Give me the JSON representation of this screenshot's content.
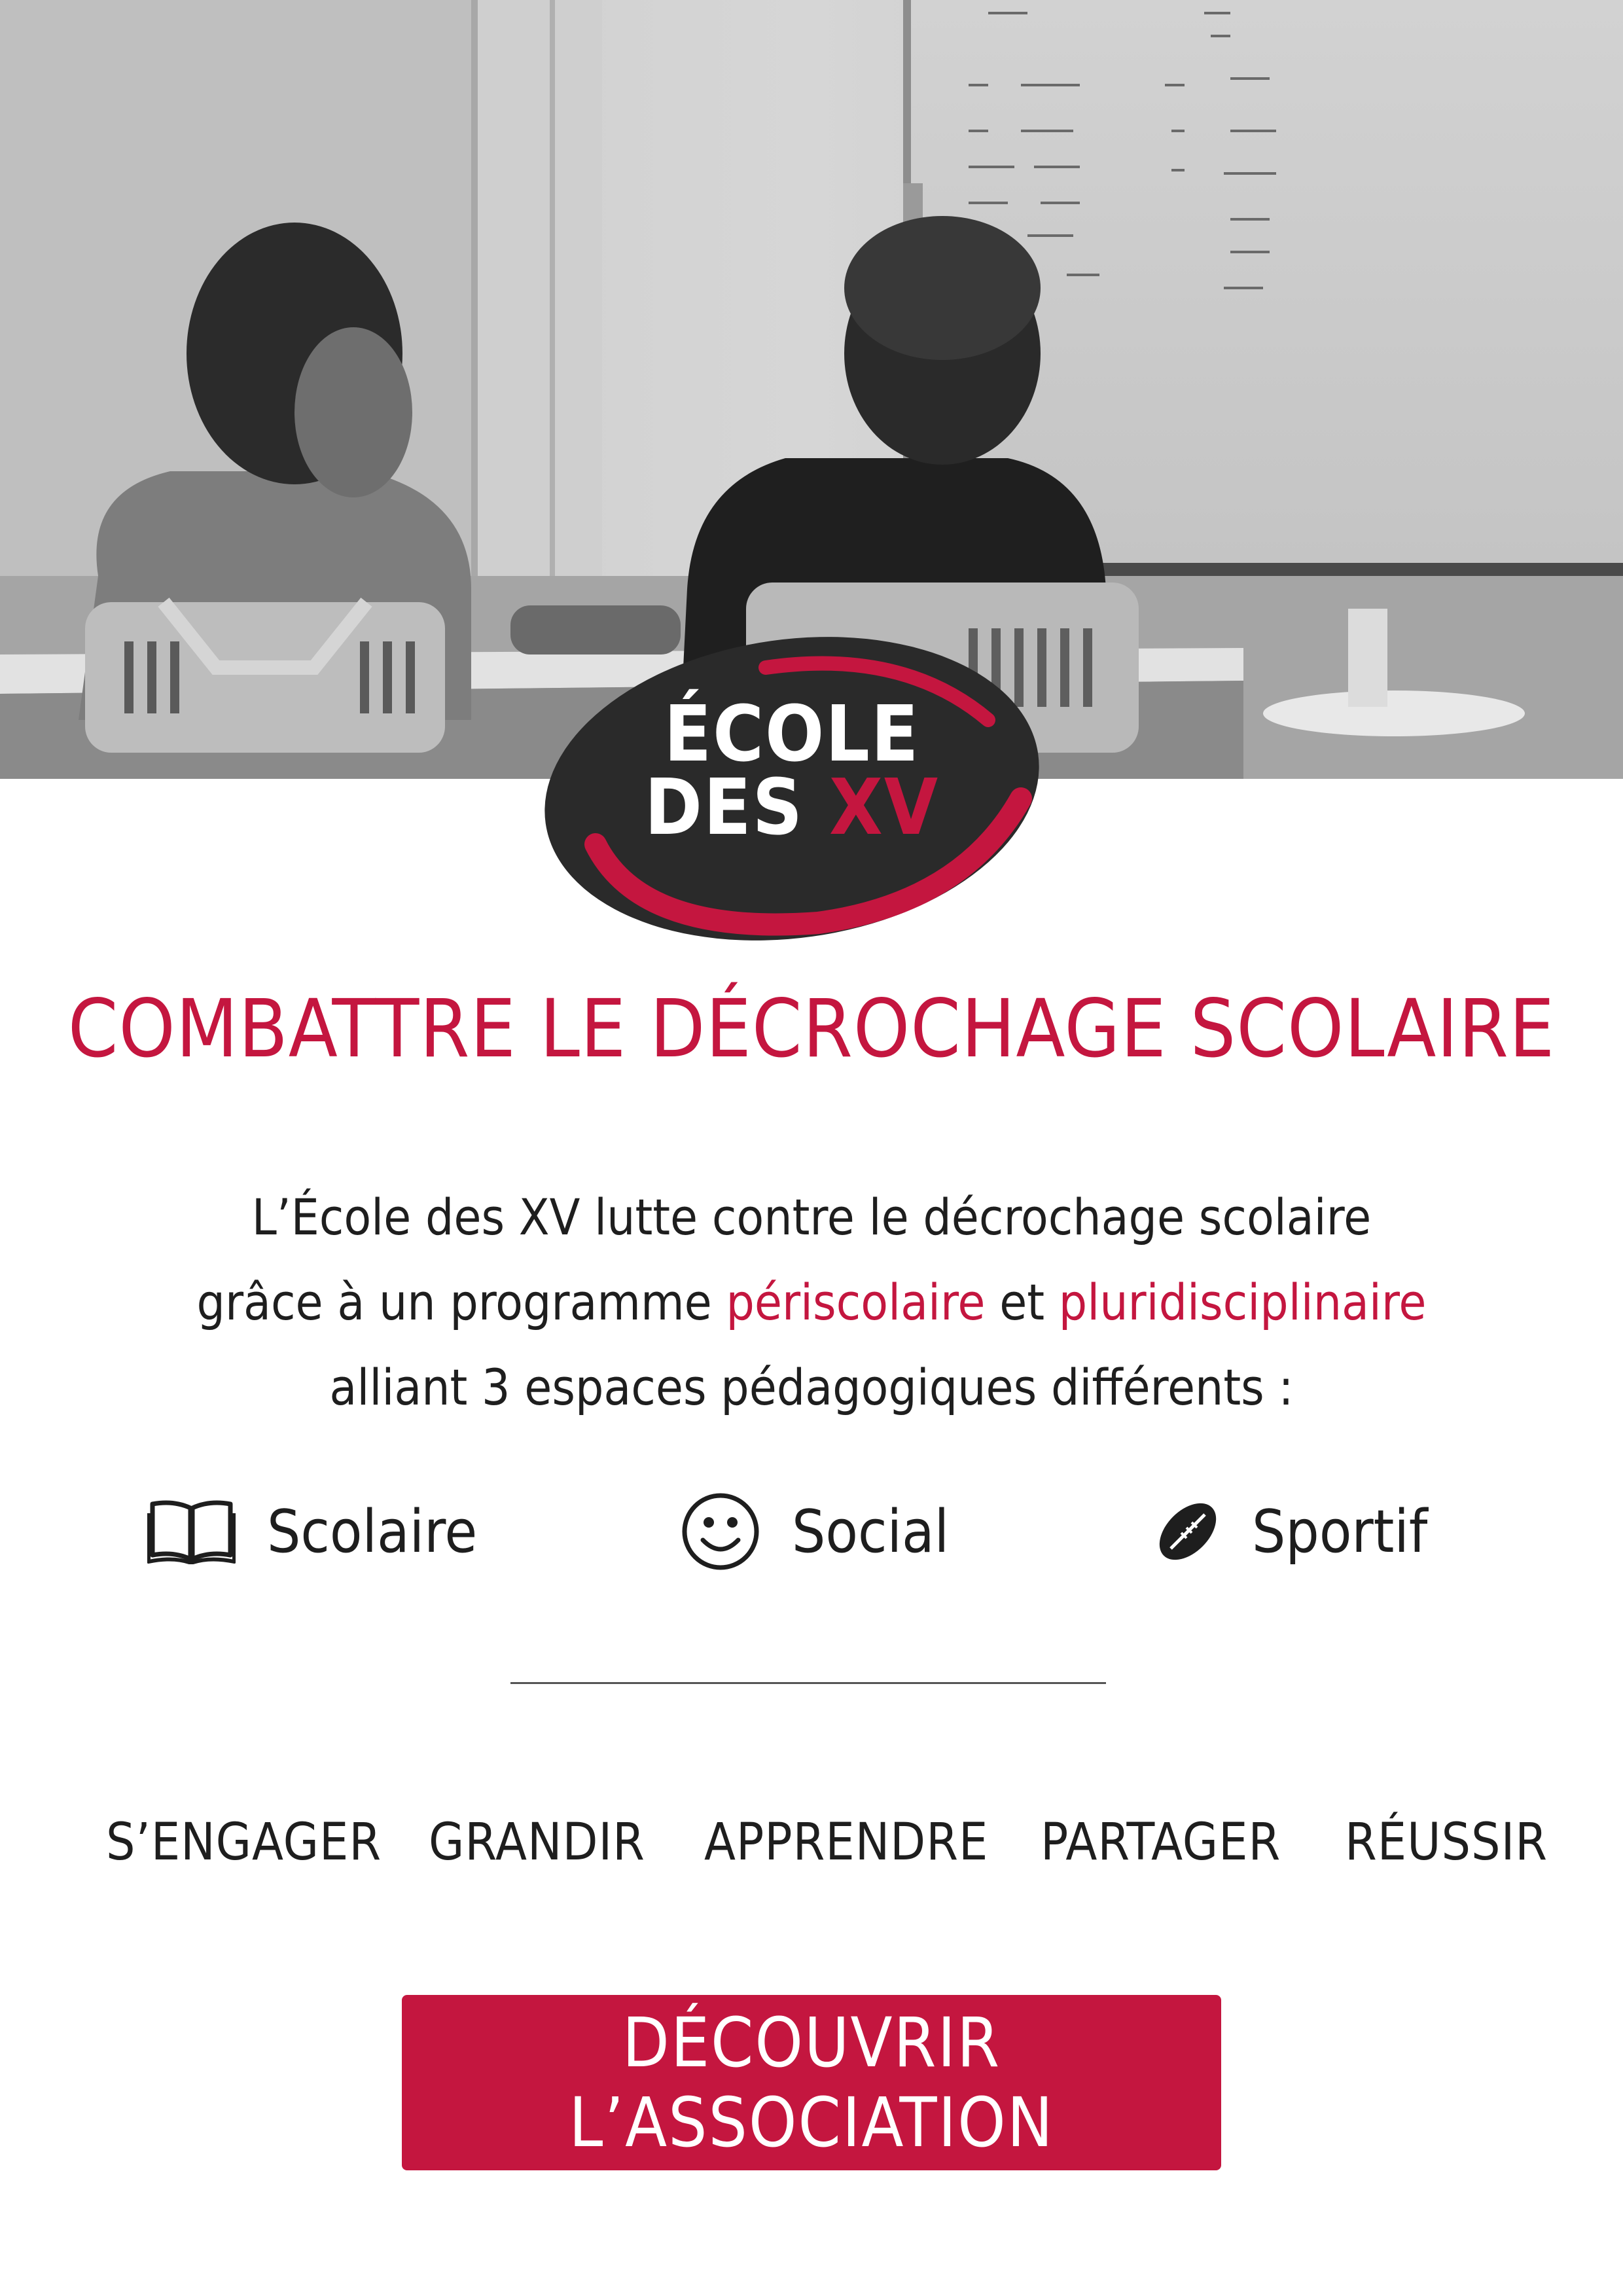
{
  "logo": {
    "line1": "ÉCOLE",
    "line2_main": "DES",
    "line2_accent": "XV"
  },
  "headline": "COMBATTRE LE DÉCROCHAGE SCOLAIRE",
  "intro": {
    "line1": "L’École des XV lutte contre le décrochage scolaire",
    "line2_start": "grâce à un programme",
    "line2_hl1": "périscolaire",
    "line2_mid": "et",
    "line2_hl2": "pluridisciplinaire",
    "line3": "alliant 3 espaces pédagogiques différents :"
  },
  "spaces": [
    {
      "label": "Scolaire",
      "icon": "book-icon"
    },
    {
      "label": "Social",
      "icon": "smiley-icon"
    },
    {
      "label": "Sportif",
      "icon": "rugby-ball-icon"
    }
  ],
  "values": [
    "S’ENGAGER",
    "GRANDIR",
    "APPRENDRE",
    "PARTAGER",
    "RÉUSSIR"
  ],
  "cta": {
    "label": "DÉCOUVRIR L’ASSOCIATION"
  },
  "colors": {
    "accent": "#c4163f",
    "text": "#1e1e1e",
    "logo_dark": "#2a2a2a"
  }
}
